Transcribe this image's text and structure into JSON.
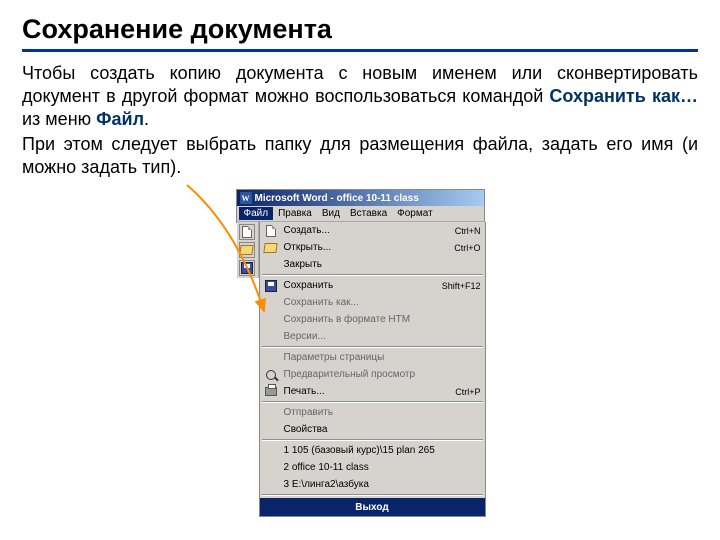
{
  "slide": {
    "title": "Сохранение документа",
    "para1_a": "Чтобы создать копию документа с новым именем или сконвертировать документ в другой формат можно воспользоваться командой ",
    "para1_b": "Сохранить как…",
    "para1_c": " из меню ",
    "para1_d": "Файл",
    "para1_e": ".",
    "para2": "При этом следует выбрать папку для размещения файла, задать его имя (и можно задать тип)."
  },
  "window": {
    "title": "Microsoft Word - office 10-11 class",
    "menu": {
      "file": "Файл",
      "edit": "Правка",
      "view": "Вид",
      "insert": "Вставка",
      "format": "Формат"
    },
    "items": {
      "create": {
        "label": "Создать...",
        "shortcut": "Ctrl+N"
      },
      "open": {
        "label": "Открыть...",
        "shortcut": "Ctrl+O"
      },
      "close": {
        "label": "Закрыть"
      },
      "save": {
        "label": "Сохранить",
        "shortcut": "Shift+F12"
      },
      "saveas": {
        "label": "Сохранить как..."
      },
      "savehtm": {
        "label": "Сохранить в формате HTM"
      },
      "versions": {
        "label": "Версии..."
      },
      "pagesetup": {
        "label": "Параметры страницы"
      },
      "preview": {
        "label": "Предварительный просмотр"
      },
      "print": {
        "label": "Печать...",
        "shortcut": "Ctrl+P"
      },
      "send": {
        "label": "Отправить"
      },
      "properties": {
        "label": "Свойства"
      },
      "recent1": {
        "label": "1 105 (базовый курс)\\15 plan 265"
      },
      "recent2": {
        "label": "2 office 10-11 class"
      },
      "recent3": {
        "label": "3 E:\\линга2\\азбука"
      },
      "exit": {
        "label": "Выход"
      }
    }
  }
}
